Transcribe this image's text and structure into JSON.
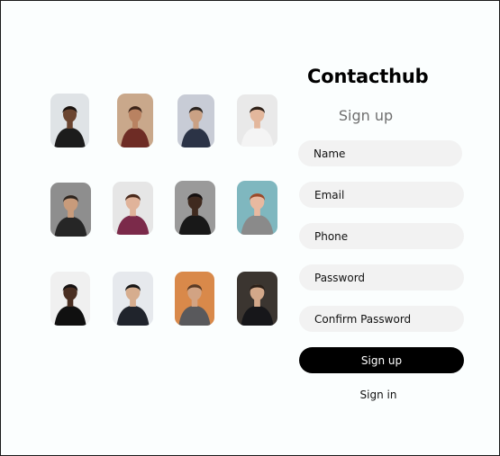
{
  "app": {
    "name": "Contacthub"
  },
  "form": {
    "title": "Sign up",
    "fields": [
      {
        "placeholder": "Name"
      },
      {
        "placeholder": "Email"
      },
      {
        "placeholder": "Phone"
      },
      {
        "placeholder": "Password"
      },
      {
        "placeholder": "Confirm Password"
      }
    ],
    "submit_label": "Sign up",
    "alt_link_label": "Sign in"
  },
  "photos": [
    {
      "bg": "#dfe3e6",
      "skin": "#6b4530",
      "hair": "#1b1410",
      "cloth": "#1c1c1c"
    },
    {
      "bg": "#c9a88b",
      "skin": "#b98261",
      "hair": "#3a2318",
      "cloth": "#6e2c25"
    },
    {
      "bg": "#c8ccd6",
      "skin": "#caa184",
      "hair": "#2a2420",
      "cloth": "#2b3346"
    },
    {
      "bg": "#e9e9e9",
      "skin": "#e3b79c",
      "hair": "#2e2018",
      "cloth": "#f4f4f4"
    },
    {
      "bg": "#8e8e8e",
      "skin": "#c89b7b",
      "hair": "#2c241e",
      "cloth": "#262626"
    },
    {
      "bg": "#e6e6e6",
      "skin": "#e0b39a",
      "hair": "#4a2a1c",
      "cloth": "#7b2a4a"
    },
    {
      "bg": "#9a9a9a",
      "skin": "#3f2a1f",
      "hair": "#141010",
      "cloth": "#181818"
    },
    {
      "bg": "#7fb7bf",
      "skin": "#e8b9a0",
      "hair": "#9a4a2a",
      "cloth": "#8a8a8a"
    },
    {
      "bg": "#f0f0f0",
      "skin": "#4a2f22",
      "hair": "#151212",
      "cloth": "#101010"
    },
    {
      "bg": "#e6e9ed",
      "skin": "#d6ad8e",
      "hair": "#161616",
      "cloth": "#20242c"
    },
    {
      "bg": "#d9894a",
      "skin": "#d2a383",
      "hair": "#5a3a24",
      "cloth": "#59595c"
    },
    {
      "bg": "#3b3530",
      "skin": "#d3a88a",
      "hair": "#2a1f18",
      "cloth": "#17171a"
    }
  ]
}
